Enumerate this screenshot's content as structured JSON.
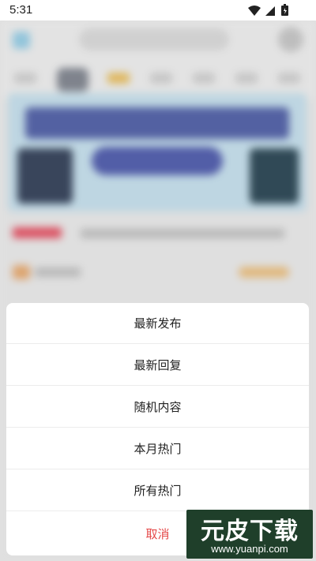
{
  "status_bar": {
    "time": "5:31",
    "icons": [
      "wifi-icon",
      "signal-icon",
      "battery-icon"
    ]
  },
  "action_sheet": {
    "items": [
      {
        "label": "最新发布"
      },
      {
        "label": "最新回复"
      },
      {
        "label": "随机内容"
      },
      {
        "label": "本月热门"
      },
      {
        "label": "所有热门"
      }
    ],
    "cancel_label": "取消"
  },
  "watermark": {
    "title": "元皮下载",
    "url": "www.yuanpi.com"
  },
  "colors": {
    "cancel": "#e54848",
    "sheet_bg": "#ffffff",
    "watermark_bg": "#1f3f2a"
  }
}
